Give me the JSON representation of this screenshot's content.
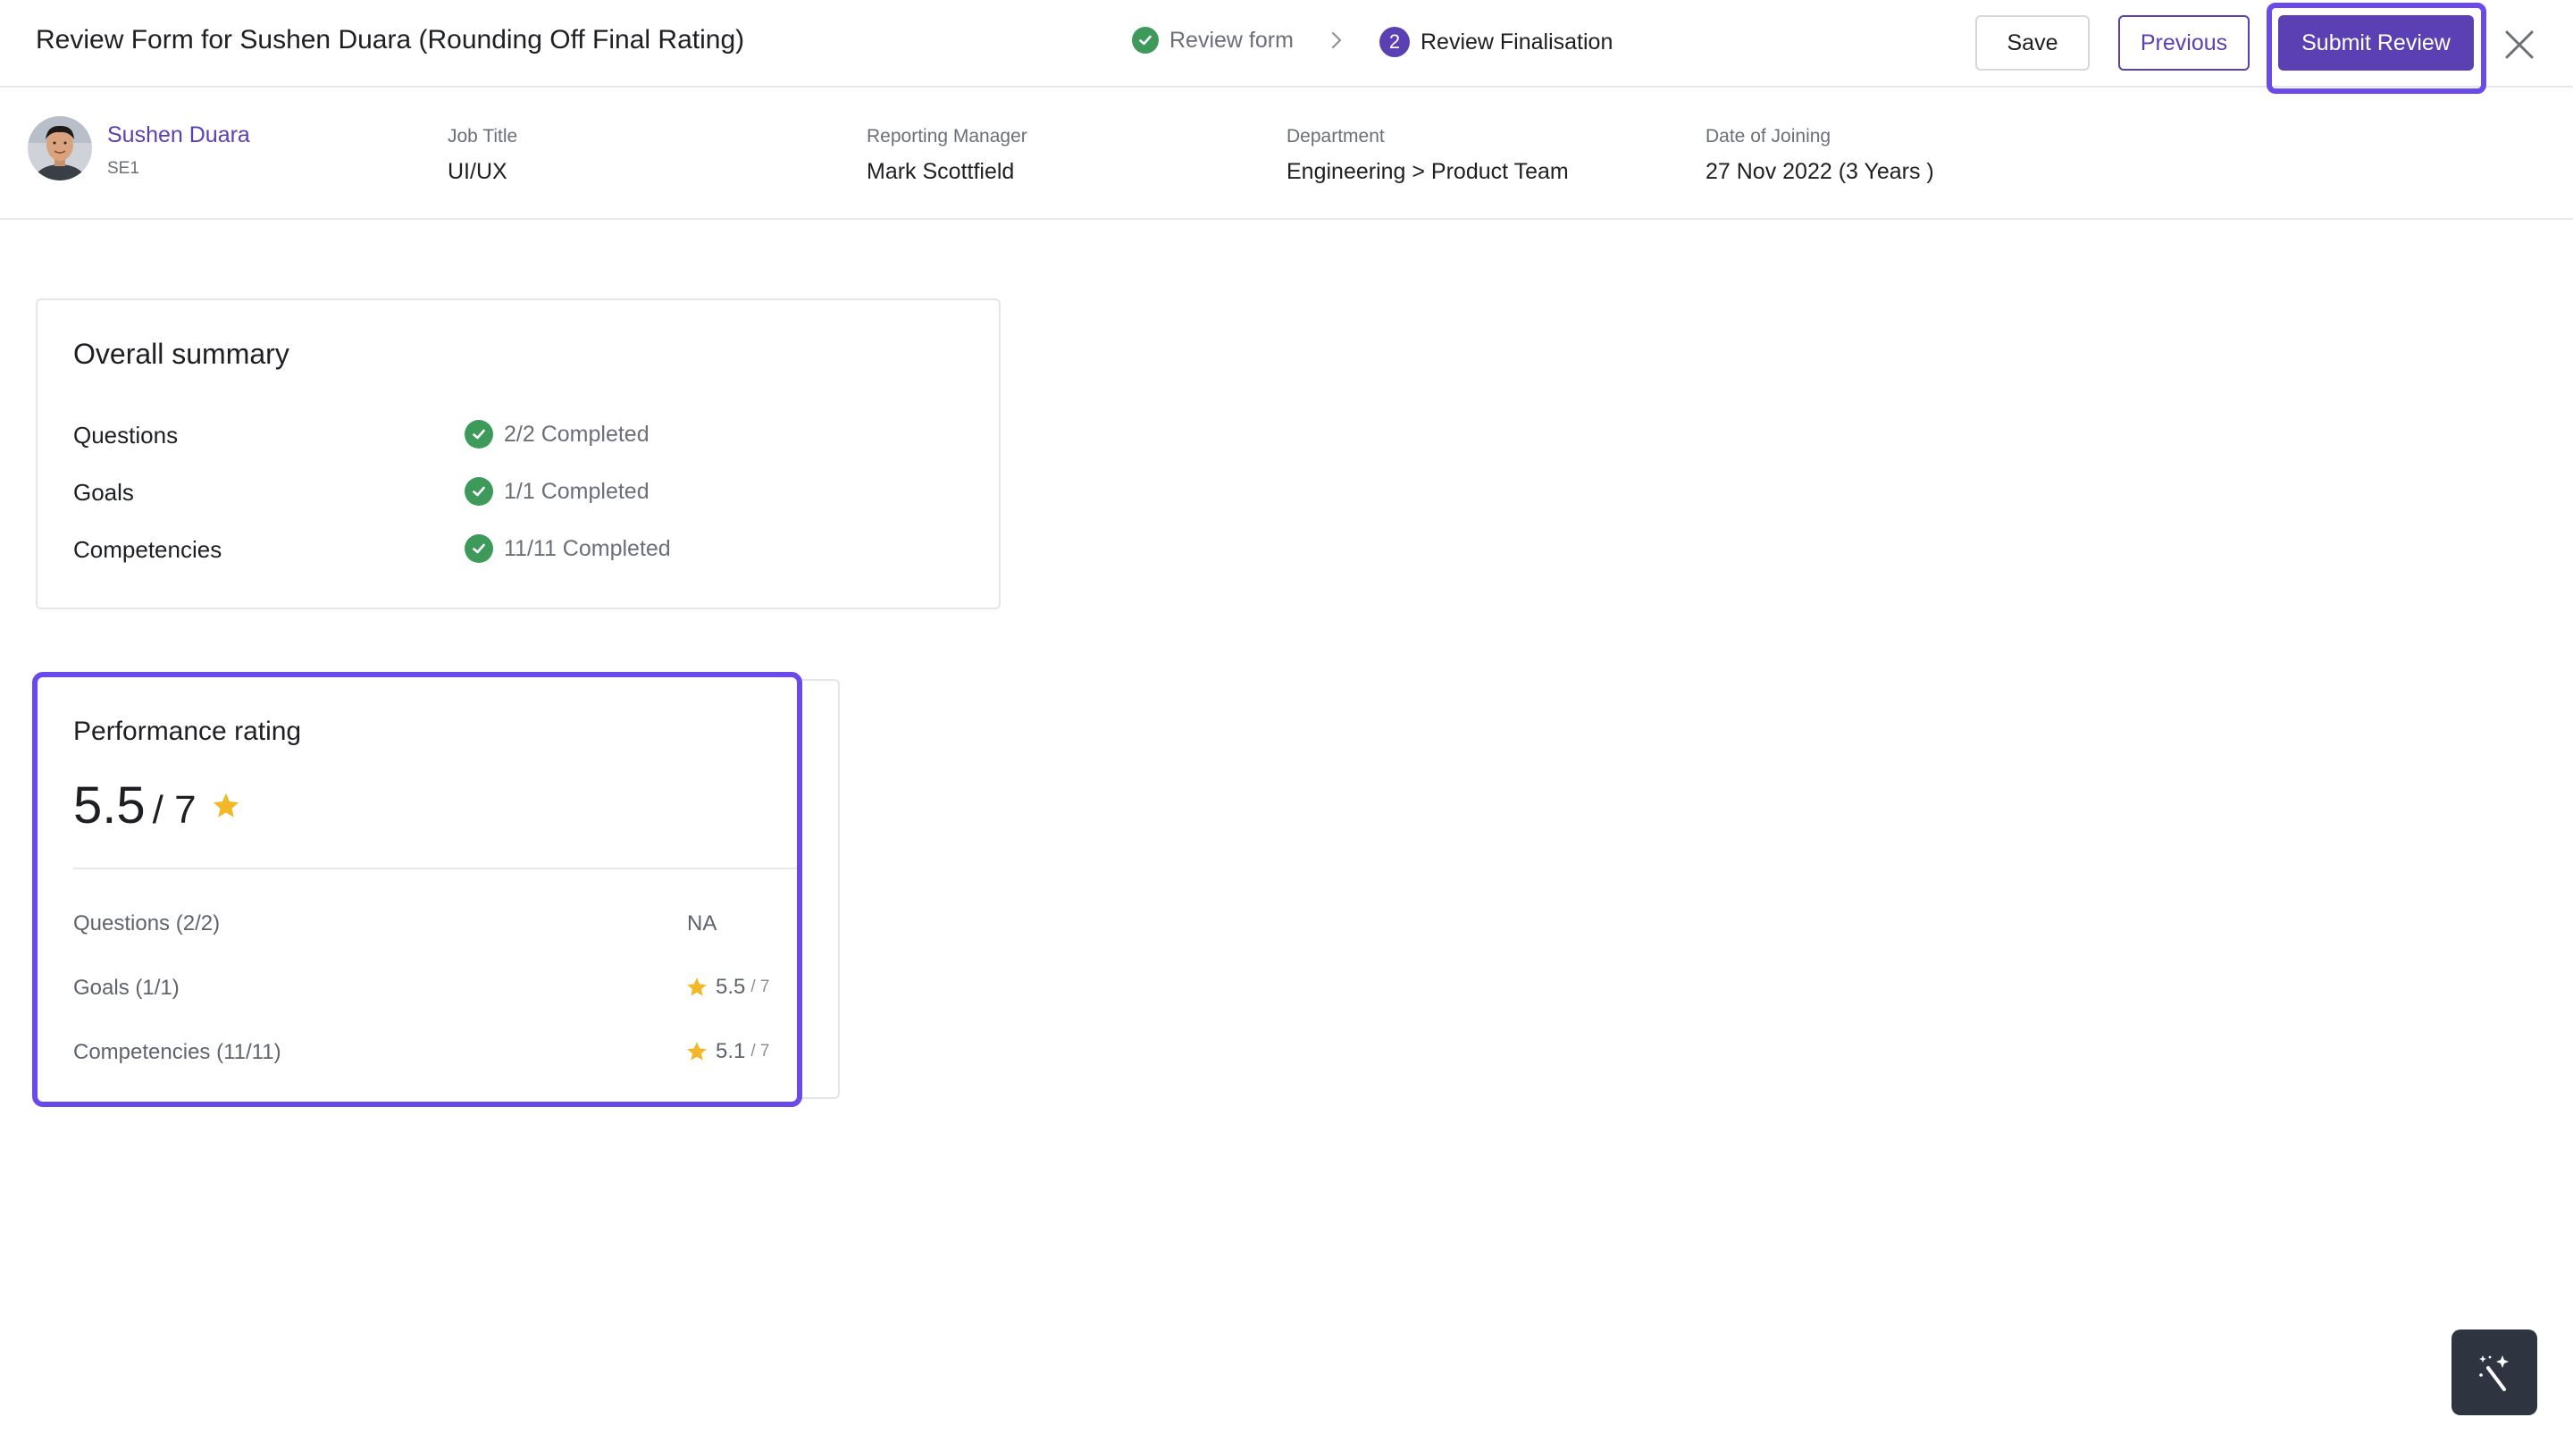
{
  "header": {
    "title": "Review Form for Sushen Duara (Rounding Off Final Rating)",
    "steps": [
      {
        "label": "Review form",
        "status": "completed"
      },
      {
        "label": "Review Finalisation",
        "number": "2",
        "status": "current"
      }
    ],
    "buttons": {
      "save": "Save",
      "previous": "Previous",
      "submit": "Submit Review"
    }
  },
  "employee": {
    "name": "Sushen Duara",
    "code": "SE1",
    "fields": [
      {
        "label": "Job Title",
        "value": "UI/UX"
      },
      {
        "label": "Reporting Manager",
        "value": "Mark Scottfield"
      },
      {
        "label": "Department",
        "value": "Engineering > Product Team"
      },
      {
        "label": "Date of Joining",
        "value": "27 Nov 2022 (3 Years )"
      }
    ]
  },
  "summary": {
    "title": "Overall summary",
    "rows": [
      {
        "label": "Questions",
        "status": "2/2 Completed"
      },
      {
        "label": "Goals",
        "status": "1/1 Completed"
      },
      {
        "label": "Competencies",
        "status": "11/11 Completed"
      }
    ]
  },
  "performance": {
    "title": "Performance rating",
    "overall": "5.5",
    "max": "/ 7",
    "rows": [
      {
        "label": "Questions (2/2)",
        "value": "NA",
        "sub": ""
      },
      {
        "label": "Goals (1/1)",
        "value": "5.5",
        "sub": "/ 7"
      },
      {
        "label": "Competencies (11/11)",
        "value": "5.1",
        "sub": "/ 7"
      }
    ]
  },
  "colors": {
    "accent": "#5b40b3",
    "highlight": "#6a4ae8",
    "success": "#3d9a5b",
    "star": "#f3b72a"
  },
  "icons": {
    "step_done": "check-circle-icon",
    "step_separator": "chevron-right-icon",
    "close": "close-icon",
    "rating": "star-icon",
    "magic": "magic-wand-icon"
  }
}
